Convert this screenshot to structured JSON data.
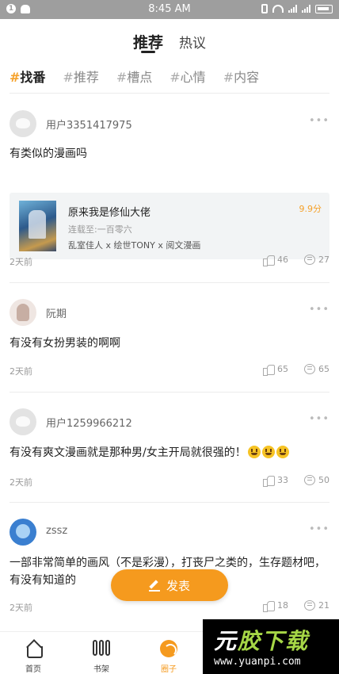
{
  "status_bar": {
    "time": "8:45 AM",
    "notif_badge": "1"
  },
  "top_tabs": [
    {
      "label": "推荐"
    },
    {
      "label": "热议"
    }
  ],
  "hashtags": [
    {
      "label": "找番"
    },
    {
      "label": "推荐"
    },
    {
      "label": "槽点"
    },
    {
      "label": "心情"
    },
    {
      "label": "内容"
    }
  ],
  "posts": [
    {
      "username": "用户3351417975",
      "content": "有类似的漫画吗",
      "comic": {
        "title": "原来我是修仙大佬",
        "score": "9.9分",
        "progress": "连载至:一百零六",
        "authors": "乱室佳人 x 绘世TONY x 阅文漫画"
      },
      "time": "2天前",
      "likes": "46",
      "comments": "27"
    },
    {
      "username": "阮期",
      "content": "有没有女扮男装的啊啊",
      "time": "2天前",
      "likes": "65",
      "comments": "65"
    },
    {
      "username": "用户1259966212",
      "content": "有没有爽文漫画就是那种男/女主开局就很强的！",
      "time": "2天前",
      "likes": "33",
      "comments": "50"
    },
    {
      "username": "zssz",
      "content": "一部非常简单的画风（不是彩漫），打丧尸之类的，生存题材吧，有没有知道的",
      "time": "2天前",
      "likes": "18",
      "comments": "21"
    }
  ],
  "publish_button": {
    "label": "发表"
  },
  "bottom_nav": [
    {
      "label": "首页"
    },
    {
      "label": "书架"
    },
    {
      "label": "圈子"
    }
  ],
  "watermark": {
    "title_a": "元",
    "title_b": "胶下载",
    "url": "www.yuanpi.com"
  },
  "colors": {
    "accent": "#f59a1e",
    "score": "#f5a12a",
    "status_bar": "#9e9e9e"
  }
}
